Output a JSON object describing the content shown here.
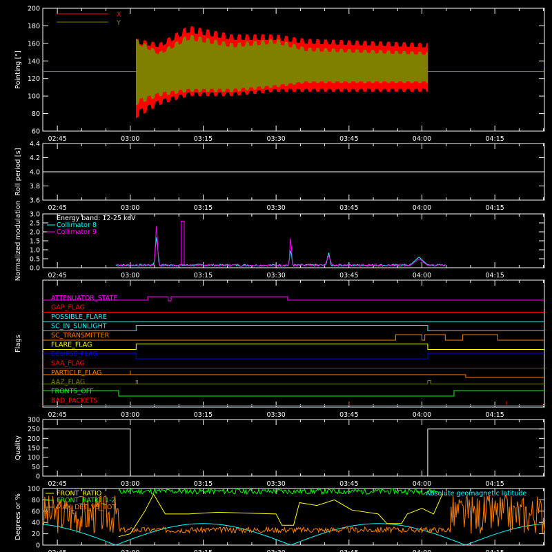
{
  "time_ticks": [
    "02:45",
    "03:00",
    "03:15",
    "03:30",
    "03:45",
    "04:00",
    "04:15"
  ],
  "chart_data": [
    {
      "type": "line",
      "panel": "pointing",
      "ylabel": "Pointing [\"]",
      "ylim": [
        60,
        200
      ],
      "yticks": [
        "200",
        "180",
        "160",
        "140",
        "120",
        "100",
        "80",
        "60"
      ],
      "legend": [
        "X",
        "Y"
      ],
      "colors": {
        "X": "#ff0000",
        "Y": "#808000"
      },
      "x": "time 02:45–04:25",
      "series": [
        {
          "name": "X",
          "envelope_upper": [
            [
              3.02,
              165
            ],
            [
              3.1,
              160
            ],
            [
              3.2,
              180
            ],
            [
              3.35,
              170
            ],
            [
              3.5,
              170
            ],
            [
              3.6,
              165
            ],
            [
              4.02,
              160
            ]
          ],
          "envelope_lower": [
            [
              3.02,
              75
            ],
            [
              3.1,
              90
            ],
            [
              3.2,
              100
            ],
            [
              3.35,
              100
            ],
            [
              3.5,
              105
            ],
            [
              3.6,
              105
            ],
            [
              4.02,
              105
            ]
          ]
        },
        {
          "name": "Y",
          "envelope_upper": [
            [
              3.02,
              165
            ],
            [
              3.1,
              150
            ],
            [
              3.2,
              170
            ],
            [
              3.35,
              160
            ],
            [
              3.5,
              165
            ],
            [
              3.6,
              155
            ],
            [
              4.02,
              150
            ]
          ],
          "envelope_lower": [
            [
              3.02,
              90
            ],
            [
              3.1,
              100
            ],
            [
              3.2,
              105
            ],
            [
              3.35,
              105
            ],
            [
              3.5,
              110
            ],
            [
              3.6,
              115
            ],
            [
              4.02,
              115
            ]
          ]
        }
      ],
      "baseline": 128
    },
    {
      "type": "line",
      "panel": "roll",
      "ylabel": "Roll period [s]",
      "ylim": [
        3.5,
        4.5
      ],
      "yticks": [
        "4.4",
        "4.2",
        "4.0",
        "3.8",
        "3.6"
      ],
      "series": [
        {
          "name": "roll",
          "value": 4.0
        }
      ]
    },
    {
      "type": "line",
      "panel": "modulation",
      "ylabel": "Normalized modulation",
      "ylim": [
        0,
        3.0
      ],
      "yticks": [
        "3.0",
        "2.5",
        "2.0",
        "1.5",
        "1.0",
        "0.5",
        "0.0"
      ],
      "legend": [
        "Energy band: 12-25 keV",
        "Collimator 8",
        "Collimator 9"
      ],
      "colors": {
        "Collimator 8": "#00ffff",
        "Collimator 9": "#ff00ff"
      }
    },
    {
      "type": "line",
      "panel": "flags",
      "ylabel": "Flags",
      "flags": [
        {
          "name": "ATTENUATOR_STATE",
          "color": "#ff00ff"
        },
        {
          "name": "GAP_FLAG",
          "color": "#ff0000"
        },
        {
          "name": "POSSIBLE_FLARE",
          "color": "#00ffff"
        },
        {
          "name": "SC_IN_SUNLIGHT",
          "color": "#00ffff"
        },
        {
          "name": "SC_TRANSMITTER",
          "color": "#ff8000"
        },
        {
          "name": "FLARE_FLAG",
          "color": "#ffff00"
        },
        {
          "name": "ECLIPSE_FLAG",
          "color": "#0000ff"
        },
        {
          "name": "SAA_FLAG",
          "color": "#ff0000"
        },
        {
          "name": "PARTICLE_FLAG",
          "color": "#ff8000"
        },
        {
          "name": "AAZ_FLAG",
          "color": "#808000"
        },
        {
          "name": "FRONTS_OFF",
          "color": "#00ff00"
        },
        {
          "name": "BAD_PACKETS",
          "color": "#ff0000"
        }
      ]
    },
    {
      "type": "line",
      "panel": "quality",
      "ylabel": "Quality",
      "ylim": [
        0,
        300
      ],
      "yticks": [
        "300",
        "250",
        "200",
        "150",
        "100",
        "50",
        "0"
      ]
    },
    {
      "type": "line",
      "panel": "bottom",
      "ylabel": "Degrees or %",
      "ylim": [
        0,
        100
      ],
      "yticks": [
        "100",
        "80",
        "60",
        "40",
        "20",
        "0"
      ],
      "legend": [
        "FRONT_RATIO",
        "FRONT_RATIO_1-2",
        "MAX_DET_VS_TOT",
        "Absolute geomagnetic latitude"
      ],
      "colors": {
        "FRONT_RATIO": "#ffff00",
        "FRONT_RATIO_1-2": "#00ff00",
        "MAX_DET_VS_TOT": "#ff8000",
        "Absolute geomagnetic latitude": "#00ffff"
      }
    }
  ]
}
